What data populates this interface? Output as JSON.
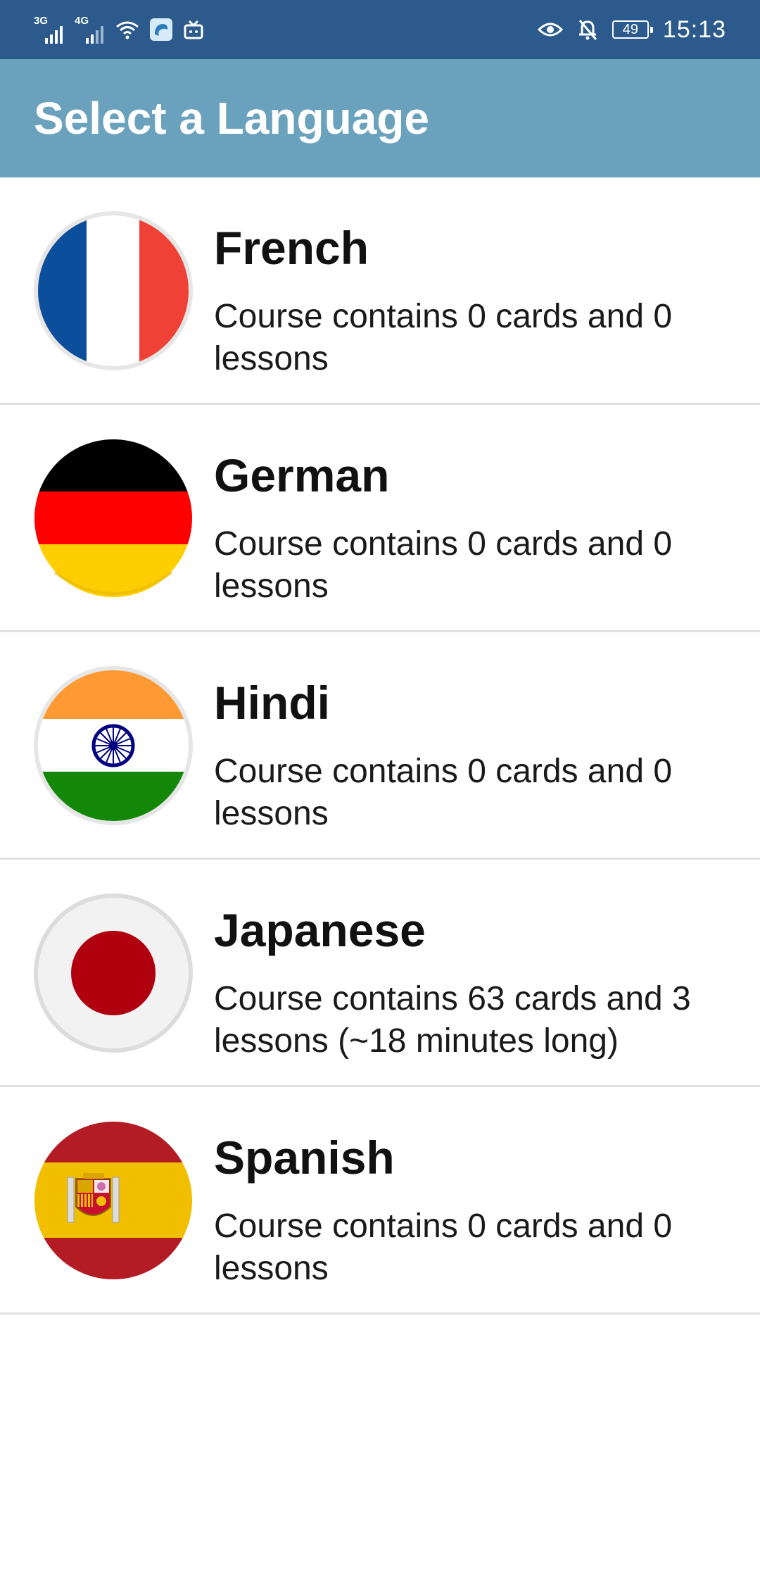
{
  "status_bar": {
    "network_1": "3G",
    "network_2": "4G",
    "battery": "49",
    "time": "15:13",
    "icons": [
      "signal-icon",
      "signal-icon",
      "wifi-icon",
      "app-notification-icon",
      "tv-icon",
      "eye-icon",
      "notifications-off-icon",
      "battery-icon"
    ]
  },
  "app_bar": {
    "title": "Select a Language",
    "color": "#6aa2bd"
  },
  "languages": [
    {
      "name": "French",
      "description": "Course contains 0 cards and 0 lessons",
      "flag": "france-flag-icon"
    },
    {
      "name": "German",
      "description": "Course contains 0 cards and 0 lessons",
      "flag": "germany-flag-icon"
    },
    {
      "name": "Hindi",
      "description": "Course contains 0 cards and 0 lessons",
      "flag": "india-flag-icon"
    },
    {
      "name": "Japanese",
      "description": "Course contains 63 cards and 3 lessons (~18 minutes long)",
      "flag": "japan-flag-icon"
    },
    {
      "name": "Spanish",
      "description": "Course contains 0 cards and 0 lessons",
      "flag": "spain-flag-icon"
    }
  ]
}
